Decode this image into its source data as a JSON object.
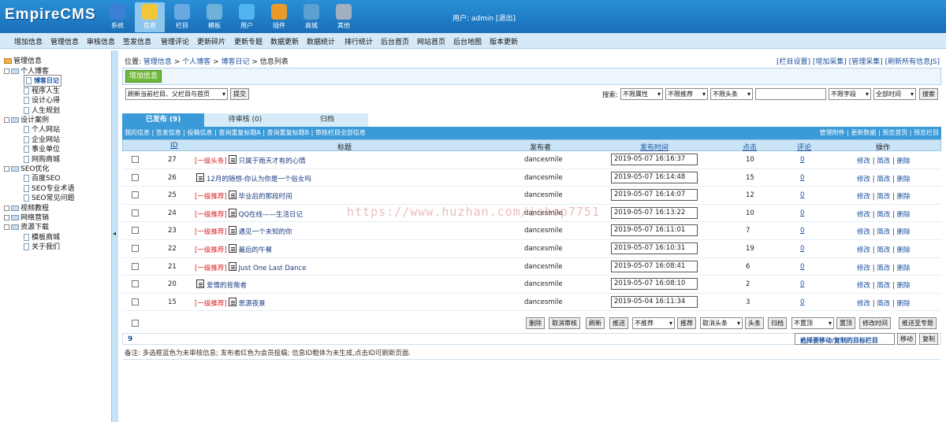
{
  "header": {
    "logo": "EmpireCMS",
    "nav": [
      {
        "label": "系统",
        "color": "#3d7fd6"
      },
      {
        "label": "信息",
        "color": "#f3c63a"
      },
      {
        "label": "栏目",
        "color": "#6aa8e2"
      },
      {
        "label": "模板",
        "color": "#6fb0d8"
      },
      {
        "label": "用户",
        "color": "#4fb4f0"
      },
      {
        "label": "插件",
        "color": "#e89a2a"
      },
      {
        "label": "商城",
        "color": "#5aa0d0"
      },
      {
        "label": "其他",
        "color": "#a0b0c0"
      }
    ],
    "user": "用户: admin [退出]"
  },
  "menu": [
    "增加信息",
    "管理信息",
    "审核信息",
    "签发信息",
    "管理评论",
    "更新碎片",
    "更新专题",
    "数据更新",
    "数据统计",
    "排行统计",
    "后台首页",
    "网站首页",
    "后台地图",
    "版本更新"
  ],
  "sidebar": {
    "root": "管理信息",
    "items": [
      {
        "label": "个人博客",
        "type": "folder"
      },
      {
        "label": "博客日记",
        "type": "doc",
        "selected": true
      },
      {
        "label": "程序人生",
        "type": "doc"
      },
      {
        "label": "设计心得",
        "type": "doc"
      },
      {
        "label": "人生规划",
        "type": "doc"
      },
      {
        "label": "设计案例",
        "type": "folder"
      },
      {
        "label": "个人网站",
        "type": "doc"
      },
      {
        "label": "企业网站",
        "type": "doc"
      },
      {
        "label": "事业单位",
        "type": "doc"
      },
      {
        "label": "网购商城",
        "type": "doc"
      },
      {
        "label": "SEO优化",
        "type": "folder"
      },
      {
        "label": "百度SEO",
        "type": "doc"
      },
      {
        "label": "SEO专业术语",
        "type": "doc"
      },
      {
        "label": "SEO常见问题",
        "type": "doc"
      },
      {
        "label": "视频教程",
        "type": "folder"
      },
      {
        "label": "网络营销",
        "type": "folder"
      },
      {
        "label": "资源下载",
        "type": "folder"
      },
      {
        "label": "模板商城",
        "type": "doc"
      },
      {
        "label": "关于我们",
        "type": "doc"
      }
    ]
  },
  "splitter": "◂",
  "breadcrumb": {
    "prefix": "位置:",
    "parts": [
      "管理信息",
      "个人博客",
      "博客日记"
    ],
    "current": "信息列表"
  },
  "right_links": "[栏目设置] [增加采集] [管理采集] [刷新所有信息JS]",
  "add_button": "增加信息",
  "refresh_select": "刷新当前栏目、父栏目与首页",
  "submit_button": "提交",
  "search": {
    "label": "搜索:",
    "attr": "不限属性",
    "recommend": "不限推荐",
    "headline": "不限头条",
    "field": "不限字段",
    "time": "全部时间",
    "button": "搜索"
  },
  "tabs": [
    "已发布 (9)",
    "待审核 (0)",
    "归档"
  ],
  "sub_left": "我的信息 | 签发信息 | 投稿信息 | 查询重复标题A | 查询重复标题B | 审核栏目全部信息",
  "sub_right": "管理附件 | 更新数据 | 预览首页 | 预览栏目",
  "columns": {
    "id": "ID",
    "title": "标题",
    "author": "发布者",
    "time": "发布时间",
    "clicks": "点击",
    "comments": "评论",
    "ops": "操作"
  },
  "rows": [
    {
      "id": "27",
      "badge": "[一级头条]",
      "title": "只属于雨天才有的心情",
      "author": "dancesmile",
      "time": "2019-05-07 16:16:37",
      "clicks": "10",
      "comments": "0"
    },
    {
      "id": "26",
      "badge": "",
      "title": "12月的随想-你认为你是一个俗女吗",
      "author": "dancesmile",
      "time": "2019-05-07 16:14:48",
      "clicks": "15",
      "comments": "0"
    },
    {
      "id": "25",
      "badge": "[一级推荐]",
      "title": "毕业后的那段时间",
      "author": "dancesmile",
      "time": "2019-05-07 16:14:07",
      "clicks": "12",
      "comments": "0"
    },
    {
      "id": "24",
      "badge": "[一级推荐]",
      "title": "QQ在线——生活日记",
      "author": "dancesmile",
      "time": "2019-05-07 16:13:22",
      "clicks": "10",
      "comments": "0"
    },
    {
      "id": "23",
      "badge": "[一级推荐]",
      "title": "遇见一个未知的你",
      "author": "dancesmile",
      "time": "2019-05-07 16:11:01",
      "clicks": "7",
      "comments": "0"
    },
    {
      "id": "22",
      "badge": "[一级推荐]",
      "title": "最后的午餐",
      "author": "dancesmile",
      "time": "2019-05-07 16:10:31",
      "clicks": "19",
      "comments": "0"
    },
    {
      "id": "21",
      "badge": "[一级推荐]",
      "title": "Just One Last Dance",
      "author": "dancesmile",
      "time": "2019-05-07 16:08:41",
      "clicks": "6",
      "comments": "0"
    },
    {
      "id": "20",
      "badge": "",
      "title": "爱情的背叛者",
      "author": "dancesmile",
      "time": "2019-05-07 16:08:10",
      "clicks": "2",
      "comments": "0"
    },
    {
      "id": "15",
      "badge": "[一级推荐]",
      "title": "思源夜景",
      "author": "dancesmile",
      "time": "2019-05-04 16:11:34",
      "clicks": "3",
      "comments": "0"
    }
  ],
  "row_ops": {
    "edit": "修改",
    "simple": "简改",
    "del": "删除",
    "sep": "|"
  },
  "actions": {
    "delete": "删除",
    "cancel_audit": "取消审核",
    "refresh": "刷新",
    "push": "推送",
    "no_recommend": "不推荐",
    "recommend": "推荐",
    "cancel_headline": "取消头条",
    "headline": "头条",
    "archive": "归档",
    "no_top": "不置顶",
    "top": "置顶",
    "edit_time": "修改时间",
    "push_special": "推送至专题"
  },
  "pager": "9",
  "move_select": "选择要移动/复制的目标栏目",
  "move_button": "移动",
  "copy_button": "复制",
  "note": "备注: 多选框蓝色为未审核信息; 发布者红色为会员投稿; 信息ID粗体为未生成,点击ID可刷新页面.",
  "watermark": "https://www.huzhan.com/ishop7751"
}
